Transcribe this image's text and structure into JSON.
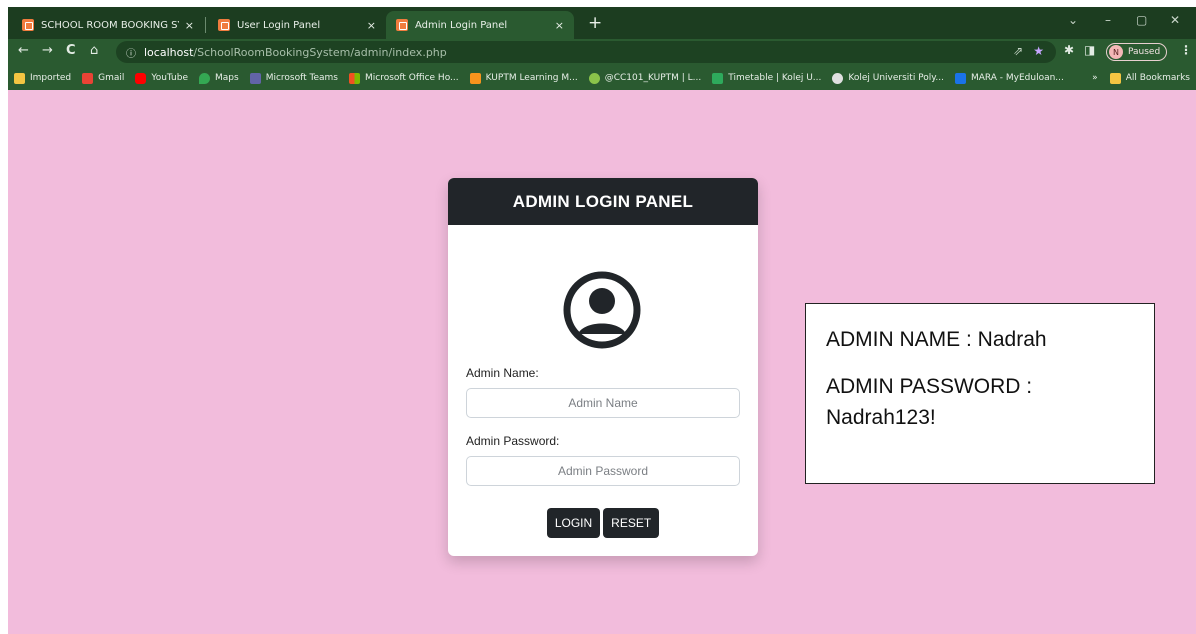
{
  "tabs": [
    {
      "title": "SCHOOL ROOM BOOKING SYST",
      "close": "×"
    },
    {
      "title": "User Login Panel",
      "close": "×"
    },
    {
      "title": "Admin Login Panel",
      "close": "×"
    }
  ],
  "new_tab": "+",
  "window_controls": {
    "chevron": "⌄",
    "minimize": "–",
    "maximize": "▢",
    "close": "✕"
  },
  "nav": {
    "back": "←",
    "forward": "→",
    "reload": "C",
    "home": "⌂"
  },
  "address": {
    "host": "localhost",
    "path": "/SchoolRoomBookingSystem/admin/index.php"
  },
  "profile": {
    "initial": "N",
    "status": "Paused"
  },
  "bookmarks": [
    {
      "label": "Imported",
      "color": "#f4c542"
    },
    {
      "label": "Gmail",
      "color": "#ea4335"
    },
    {
      "label": "YouTube",
      "color": "#ff0000"
    },
    {
      "label": "Maps",
      "color": "#34a853"
    },
    {
      "label": "Microsoft Teams",
      "color": "#6264a7"
    },
    {
      "label": "Microsoft Office Ho...",
      "color": "#f25022"
    },
    {
      "label": "KUPTM Learning M...",
      "color": "#f7941d"
    },
    {
      "label": "@CC101_KUPTM | L...",
      "color": "#8bc34a"
    },
    {
      "label": "Timetable | Kolej U...",
      "color": "#2eaa5c"
    },
    {
      "label": "Kolej Universiti Poly...",
      "color": "#e0e0e0"
    },
    {
      "label": "MARA - MyEduloan...",
      "color": "#1a73e8"
    }
  ],
  "bookmarks_overflow": "»",
  "all_bookmarks": "All Bookmarks",
  "login": {
    "title": "ADMIN LOGIN PANEL",
    "name_label": "Admin Name:",
    "name_placeholder": "Admin Name",
    "password_label": "Admin Password:",
    "password_placeholder": "Admin Password",
    "login_button": "LOGIN",
    "reset_button": "RESET"
  },
  "note": {
    "line1": "ADMIN NAME : Nadrah",
    "line2": "ADMIN PASSWORD :",
    "line3": "Nadrah123!"
  },
  "colors": {
    "page_bg": "#f2bcdc",
    "header_bg": "#212529",
    "browser_frame": "#2a5a30"
  }
}
